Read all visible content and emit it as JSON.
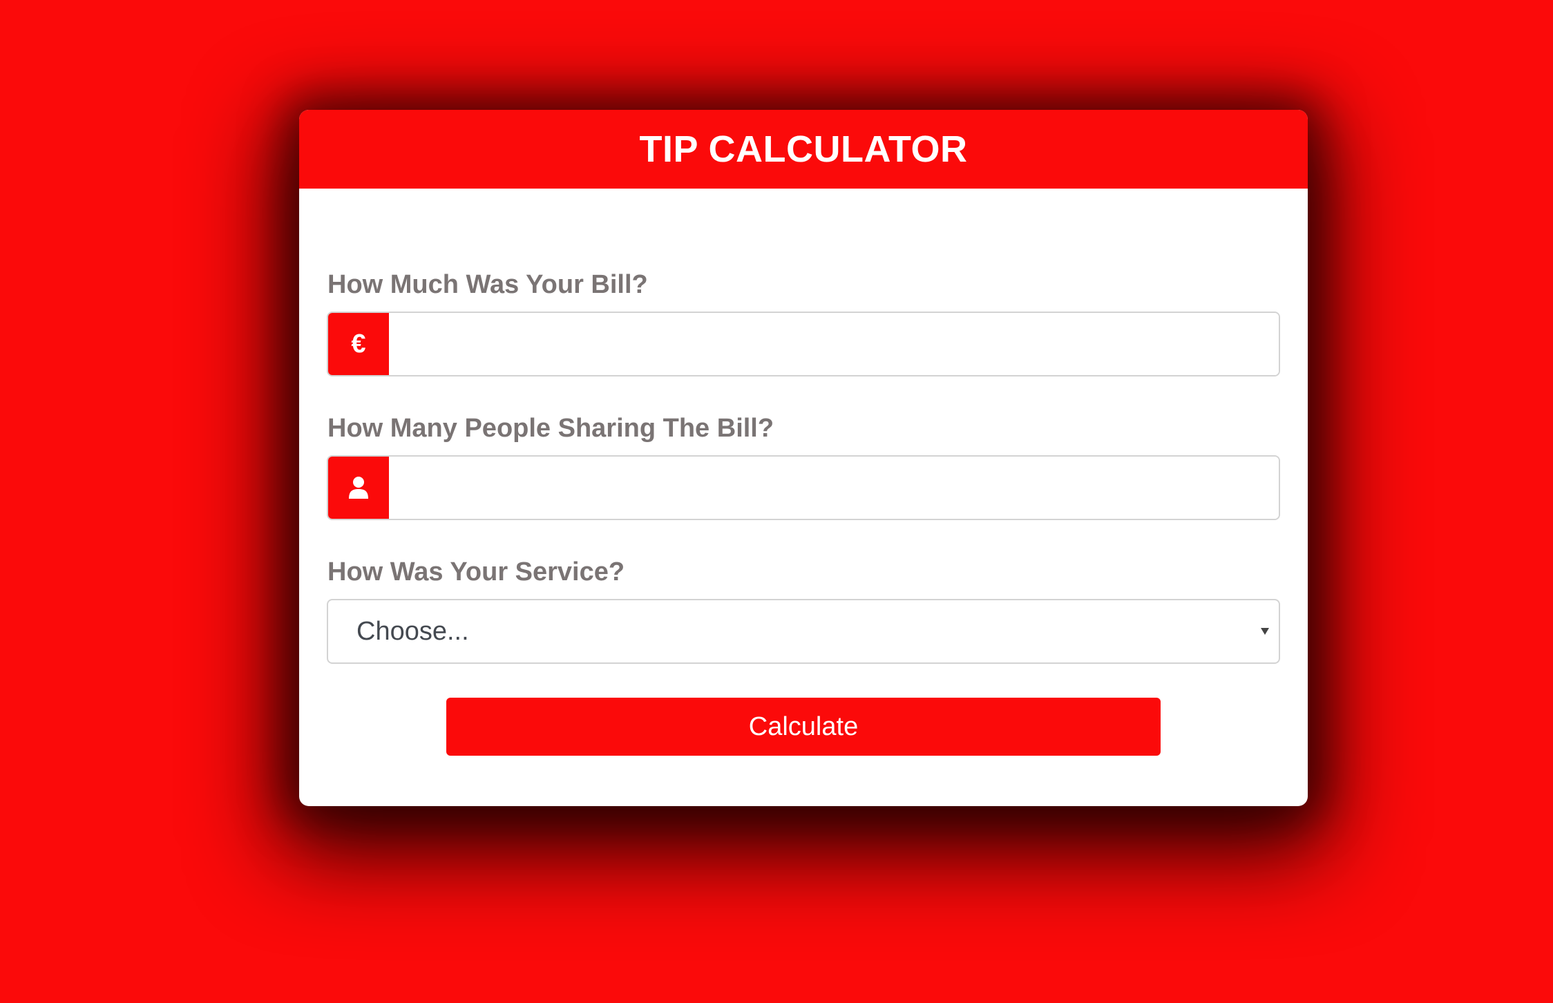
{
  "header": {
    "title": "TIP CALCULATOR"
  },
  "bill": {
    "label": "How Much Was Your Bill?",
    "currency_symbol": "€",
    "value": "",
    "placeholder": ""
  },
  "people": {
    "label": "How Many People Sharing The Bill?",
    "icon": "user-icon",
    "value": "",
    "placeholder": ""
  },
  "service": {
    "label": "How Was Your Service?",
    "selected": "Choose..."
  },
  "actions": {
    "calculate_label": "Calculate"
  },
  "colors": {
    "accent": "#fb0a0a",
    "label_text": "#7a7474",
    "card_background": "#ffffff"
  }
}
